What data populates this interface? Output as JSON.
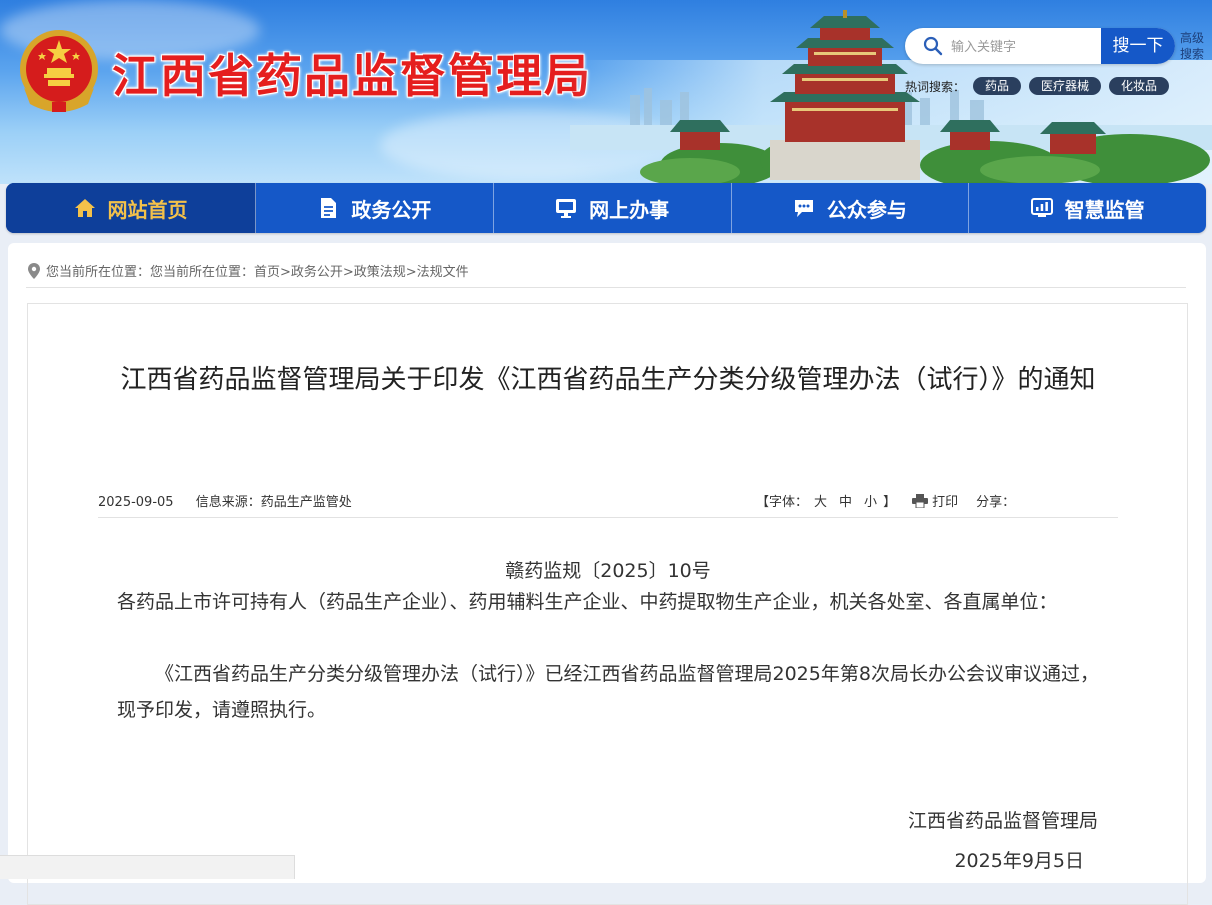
{
  "header": {
    "site_title": "江西省药品监督管理局",
    "search_placeholder": "输入关键字",
    "search_button": "搜一下",
    "advanced_search": "高级搜索",
    "hot_label": "热词搜索：",
    "hot_words": [
      "药品",
      "医疗器械",
      "化妆品"
    ]
  },
  "nav": {
    "items": [
      {
        "label": "网站首页",
        "icon": "home-icon"
      },
      {
        "label": "政务公开",
        "icon": "document-icon"
      },
      {
        "label": "网上办事",
        "icon": "monitor-icon"
      },
      {
        "label": "公众参与",
        "icon": "chat-icon"
      },
      {
        "label": "智慧监管",
        "icon": "dashboard-icon"
      }
    ],
    "active_color": "#f3c14a",
    "bar_color": "#1558c8"
  },
  "breadcrumb": {
    "text": "您当前所在位置：您当前所在位置：首页>政务公开>政策法规>法规文件"
  },
  "article": {
    "title": "江西省药品监督管理局关于印发《江西省药品生产分类分级管理办法（试行）》的通知",
    "date": "2025-09-05",
    "source": "信息来源：药品生产监管处",
    "font_size_label": "【字体：",
    "font_large": "大",
    "font_medium": "中",
    "font_small": "小",
    "font_close": "】",
    "print": "打印",
    "share": "分享：",
    "doc_number": "赣药监规〔2025〕10号",
    "recipients": "各药品上市许可持有人（药品生产企业）、药用辅料生产企业、中药提取物生产企业，机关各处室、各直属单位：",
    "body": "《江西省药品生产分类分级管理办法（试行）》已经江西省药品监督管理局2025年第8次局长办公会议审议通过，现予印发，请遵照执行。",
    "signature_org": "江西省药品监督管理局",
    "signature_date": "2025年9月5日"
  }
}
